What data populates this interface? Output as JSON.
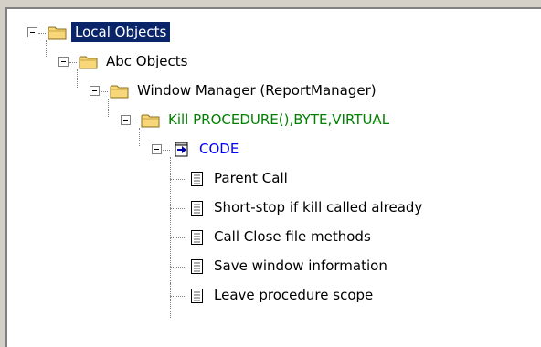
{
  "tree": {
    "nodes": [
      {
        "label": "Local Objects",
        "icon": "folder-icon",
        "selected": true,
        "color": "#ffffff"
      },
      {
        "label": "Abc Objects",
        "icon": "folder-icon",
        "color": "#000000"
      },
      {
        "label": "Window Manager (ReportManager)",
        "icon": "folder-icon",
        "color": "#000000"
      },
      {
        "label": "Kill PROCEDURE(),BYTE,VIRTUAL",
        "icon": "folder-icon",
        "color": "#008000"
      },
      {
        "label": "CODE",
        "icon": "code-embed-icon",
        "color": "#0000ff"
      },
      {
        "label": "Parent Call",
        "icon": "document-icon",
        "color": "#000000"
      },
      {
        "label": "Short-stop if kill called already",
        "icon": "document-icon",
        "color": "#000000"
      },
      {
        "label": "Call Close file methods",
        "icon": "document-icon",
        "color": "#000000"
      },
      {
        "label": "Save window information",
        "icon": "document-icon",
        "color": "#000000"
      },
      {
        "label": "Leave procedure scope",
        "icon": "document-icon",
        "color": "#000000"
      }
    ]
  },
  "colors": {
    "selection_bg": "#0a246a",
    "background": "#ffffff",
    "chrome": "#d4d0c8"
  }
}
